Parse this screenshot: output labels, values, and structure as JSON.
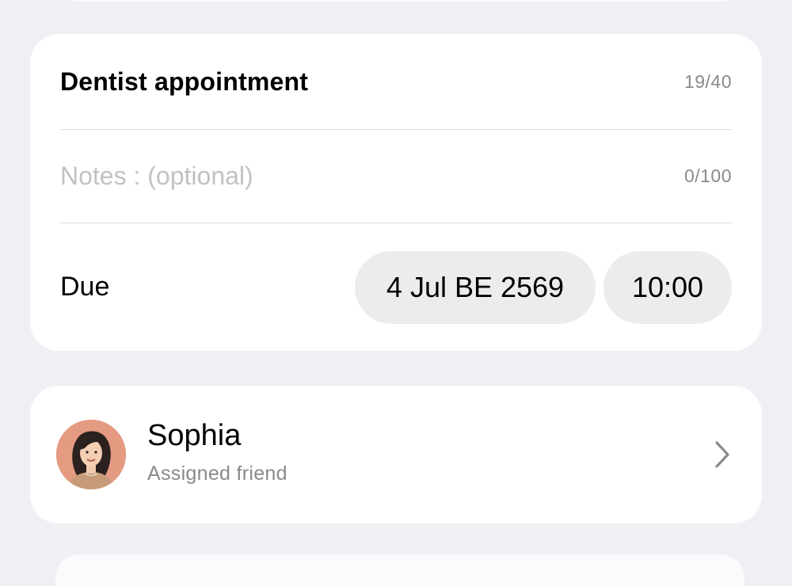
{
  "task": {
    "title": "Dentist appointment",
    "title_counter": "19/40",
    "notes_placeholder": "Notes : (optional)",
    "notes_value": "",
    "notes_counter": "0/100",
    "due_label": "Due",
    "due_date": "4 Jul BE 2569",
    "due_time": "10:00"
  },
  "friend": {
    "name": "Sophia",
    "subtitle": "Assigned friend",
    "avatar_icon": "avatar-illustration",
    "chevron_icon": "chevron-right-icon"
  },
  "colors": {
    "background": "#efeff4",
    "card": "#ffffff",
    "pill": "#ececef",
    "secondary_text": "#8a8a8e",
    "placeholder_text": "#c2c2c6",
    "avatar_bg": "#e59a82"
  }
}
